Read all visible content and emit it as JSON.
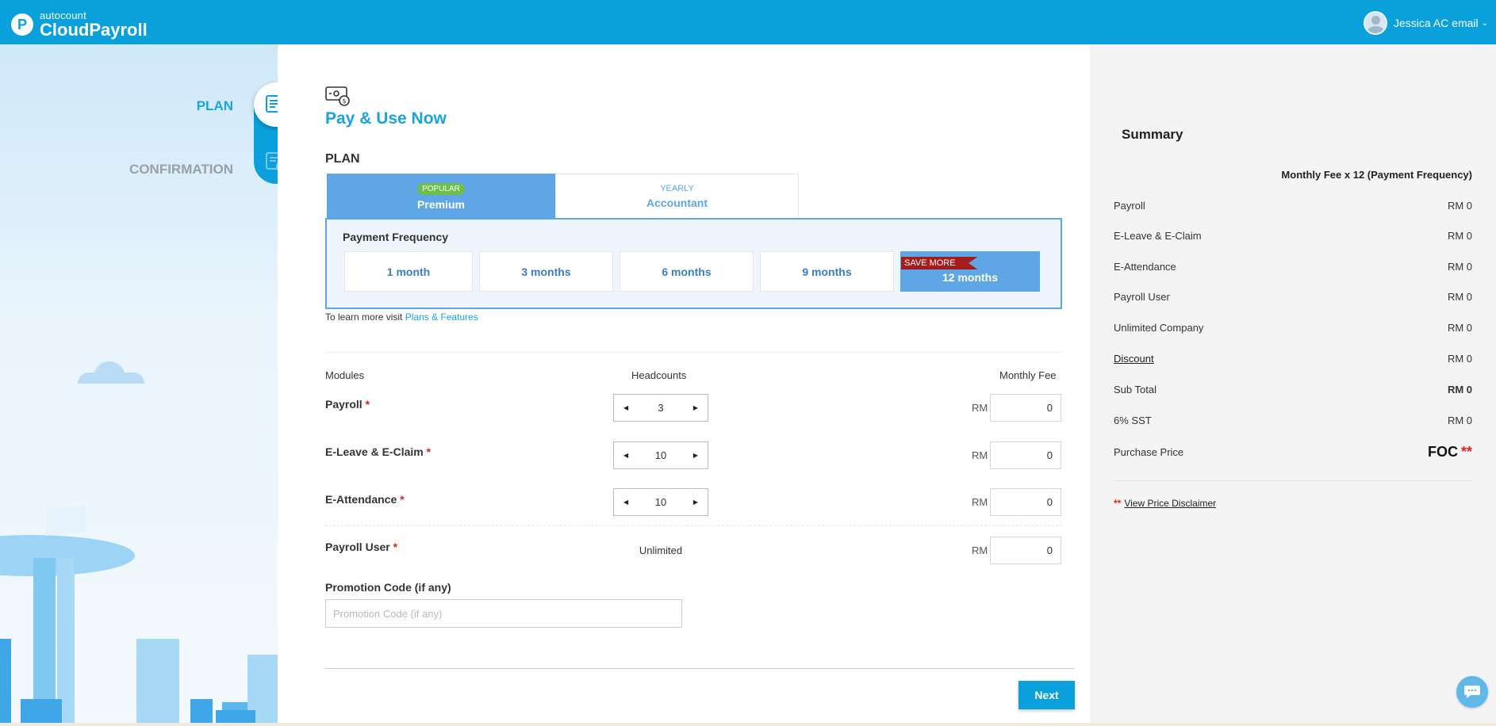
{
  "header": {
    "brand_small": "autocount",
    "brand_big": "CloudPayroll",
    "user_name": "Jessica AC email"
  },
  "steps": {
    "plan": "PLAN",
    "confirmation": "CONFIRMATION"
  },
  "main": {
    "title": "Pay & Use Now",
    "plan_heading": "PLAN",
    "plans": [
      {
        "badge": "POPULAR",
        "name": "Premium"
      },
      {
        "badge": "YEARLY",
        "name": "Accountant"
      }
    ],
    "frequency": {
      "label": "Payment Frequency",
      "options": [
        "1 month",
        "3 months",
        "6 months",
        "9 months",
        "12 months"
      ],
      "ribbon": "SAVE MORE"
    },
    "learn_prefix": "To learn more visit",
    "learn_link": "Plans & Features",
    "columns": {
      "modules": "Modules",
      "headcounts": "Headcounts",
      "monthly_fee": "Monthly Fee"
    },
    "rows": [
      {
        "label": "Payroll",
        "headcount": "3",
        "fee": "0"
      },
      {
        "label": "E-Leave & E-Claim",
        "headcount": "10",
        "fee": "0"
      },
      {
        "label": "E-Attendance",
        "headcount": "10",
        "fee": "0"
      },
      {
        "label": "Payroll User",
        "headcount": "Unlimited",
        "fee": "0"
      }
    ],
    "required_mark": "*",
    "currency": "RM",
    "promo_label": "Promotion Code (if any)",
    "promo_placeholder": "Promotion Code (if any)",
    "next_label": "Next"
  },
  "summary": {
    "title": "Summary",
    "subtitle": "Monthly Fee x 12 (Payment Frequency)",
    "rows": [
      {
        "label": "Payroll",
        "value": "RM 0"
      },
      {
        "label": "E-Leave & E-Claim",
        "value": "RM 0"
      },
      {
        "label": "E-Attendance",
        "value": "RM 0"
      },
      {
        "label": "Payroll User",
        "value": "RM 0"
      },
      {
        "label": "Unlimited Company",
        "value": "RM 0"
      },
      {
        "label": "Discount",
        "value": "RM 0"
      },
      {
        "label": "Sub Total",
        "value": "RM 0"
      },
      {
        "label": "6% SST",
        "value": "RM 0"
      }
    ],
    "purchase_label": "Purchase Price",
    "purchase_value": "FOC",
    "stars": "**",
    "disclaimer_link": "View Price Disclaimer"
  },
  "colors": {
    "brand_blue": "#0aa0dc",
    "plan_blue": "#5ea6e6",
    "popular_green": "#6cc04a",
    "ribbon_red": "#a51c1c"
  }
}
